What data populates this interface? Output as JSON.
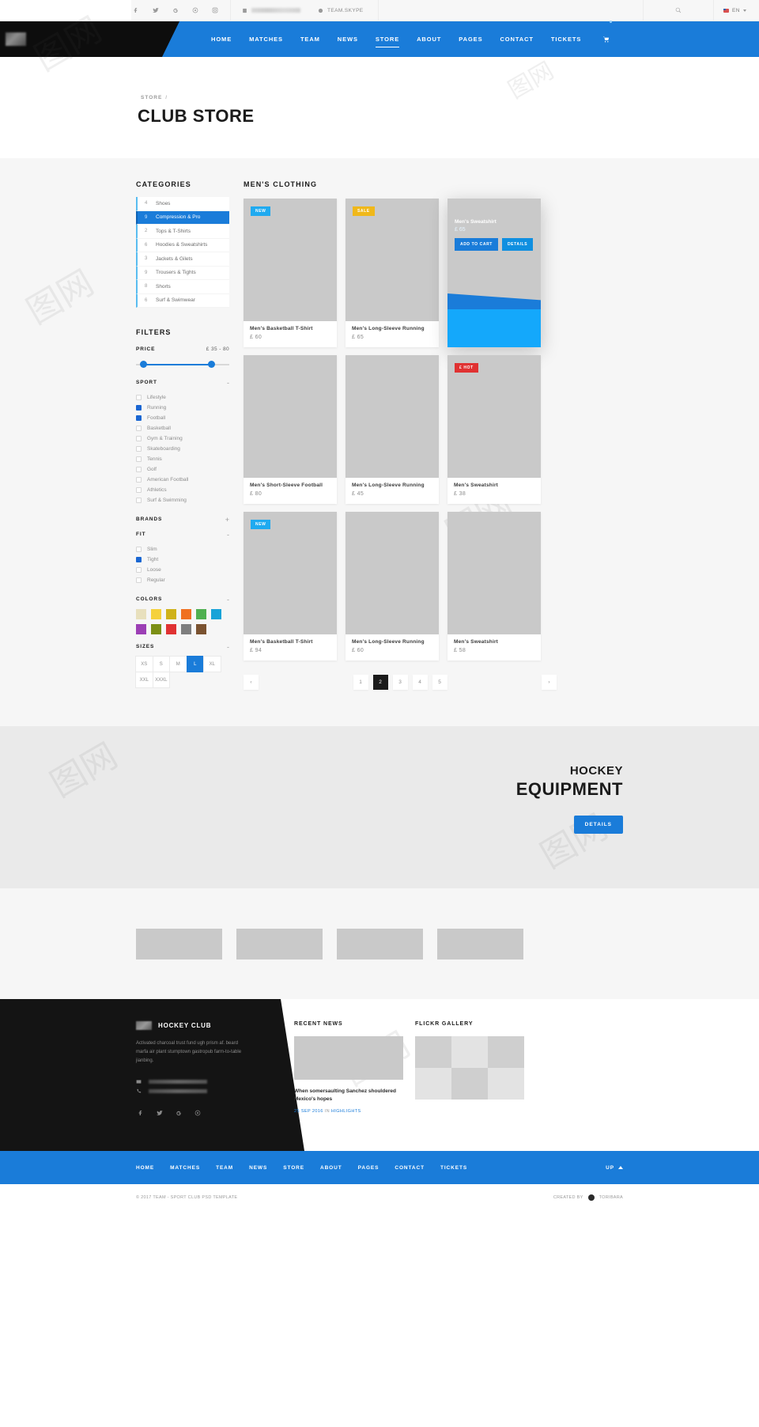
{
  "topbar": {
    "social": [
      "facebook-icon",
      "twitter-icon",
      "google-plus-icon",
      "pinterest-icon",
      "instagram-icon"
    ],
    "phone_masked": "",
    "skype_label": "TEAM.SKYPE",
    "search_icon": "search-icon",
    "language": "EN"
  },
  "nav": {
    "links": [
      {
        "label": "HOME",
        "active": false
      },
      {
        "label": "MATCHES",
        "active": false
      },
      {
        "label": "TEAM",
        "active": false
      },
      {
        "label": "NEWS",
        "active": false
      },
      {
        "label": "STORE",
        "active": true
      },
      {
        "label": "ABOUT",
        "active": false
      },
      {
        "label": "PAGES",
        "active": false
      },
      {
        "label": "CONTACT",
        "active": false
      },
      {
        "label": "TICKETS",
        "active": false
      }
    ],
    "cart_icon": "shopping-cart-icon"
  },
  "hero": {
    "breadcrumb": "STORE",
    "breadcrumb_sep": "/",
    "title": "CLUB STORE"
  },
  "sidebar": {
    "categories_heading": "CATEGORIES",
    "categories": [
      {
        "count": "4",
        "label": "Shoes",
        "active": false
      },
      {
        "count": "9",
        "label": "Compression & Pro",
        "active": true
      },
      {
        "count": "2",
        "label": "Tops & T-Shirts",
        "active": false
      },
      {
        "count": "6",
        "label": "Hoodies & Sweatshirts",
        "active": false
      },
      {
        "count": "3",
        "label": "Jackets & Gilets",
        "active": false
      },
      {
        "count": "9",
        "label": "Trousers & Tights",
        "active": false
      },
      {
        "count": "8",
        "label": "Shorts",
        "active": false
      },
      {
        "count": "6",
        "label": "Surf & Swimwear",
        "active": false
      }
    ],
    "filters_heading": "FILTERS",
    "price": {
      "label": "PRICE",
      "value": "£ 35 - 80"
    },
    "sport": {
      "label": "SPORT",
      "toggle": "-",
      "options": [
        {
          "label": "Lifestyle",
          "checked": false
        },
        {
          "label": "Running",
          "checked": true
        },
        {
          "label": "Football",
          "checked": true
        },
        {
          "label": "Basketball",
          "checked": false
        },
        {
          "label": "Gym & Training",
          "checked": false
        },
        {
          "label": "Skateboarding",
          "checked": false
        },
        {
          "label": "Tennis",
          "checked": false
        },
        {
          "label": "Golf",
          "checked": false
        },
        {
          "label": "American Football",
          "checked": false
        },
        {
          "label": "Athletics",
          "checked": false
        },
        {
          "label": "Surf & Swimming",
          "checked": false
        }
      ]
    },
    "brands": {
      "label": "BRANDS",
      "toggle": "+"
    },
    "fit": {
      "label": "FIT",
      "toggle": "-",
      "options": [
        {
          "label": "Slim",
          "checked": false
        },
        {
          "label": "Tight",
          "checked": true
        },
        {
          "label": "Loose",
          "checked": false
        },
        {
          "label": "Regular",
          "checked": false
        }
      ]
    },
    "colors": {
      "label": "COLORS",
      "toggle": "-",
      "swatches": [
        "#e8e0bd",
        "#f5d13c",
        "#cfb21a",
        "#f07020",
        "#4fb050",
        "#18a3d8",
        "#9c3fb5",
        "#7c8f15",
        "#e03232",
        "#7e7e7e",
        "#7a5230"
      ]
    },
    "sizes": {
      "label": "SIZES",
      "toggle": "-",
      "options": [
        {
          "label": "XS",
          "selected": false
        },
        {
          "label": "S",
          "selected": false
        },
        {
          "label": "M",
          "selected": false
        },
        {
          "label": "L",
          "selected": true
        },
        {
          "label": "XL",
          "selected": false
        },
        {
          "label": "XXL",
          "selected": false
        },
        {
          "label": "XXXL",
          "selected": false
        }
      ]
    }
  },
  "products": {
    "heading": "MEN'S CLOTHING",
    "items": [
      {
        "name": "Men's Basketball T-Shirt",
        "price": "£ 60",
        "badge": "NEW",
        "badge_type": "new",
        "hover": false
      },
      {
        "name": "Men's Long-Sleeve Running",
        "price": "£ 65",
        "badge": "SALE",
        "badge_type": "sale",
        "hover": false
      },
      {
        "name": "Men's Sweatshirt",
        "price": "£ 65",
        "badge": "",
        "badge_type": "",
        "hover": true,
        "add_to_cart": "ADD TO CART",
        "details": "DETAILS"
      },
      {
        "name": "Men's Short-Sleeve Football",
        "price": "£ 80",
        "badge": "",
        "badge_type": "",
        "hover": false
      },
      {
        "name": "Men's Long-Sleeve Running",
        "price": "£ 45",
        "badge": "",
        "badge_type": "",
        "hover": false
      },
      {
        "name": "Men's Sweatshirt",
        "price": "£ 38",
        "badge": "£ HOT",
        "badge_type": "hot",
        "hover": false
      },
      {
        "name": "Men's Basketball T-Shirt",
        "price": "£ 94",
        "badge": "NEW",
        "badge_type": "new",
        "hover": false
      },
      {
        "name": "Men's Long-Sleeve Running",
        "price": "£ 60",
        "badge": "",
        "badge_type": "",
        "hover": false
      },
      {
        "name": "Men's Sweatshirt",
        "price": "£ 58",
        "badge": "",
        "badge_type": "",
        "hover": false
      }
    ],
    "pagination": {
      "prev": "‹",
      "next": "›",
      "pages": [
        "1",
        "2",
        "3",
        "4",
        "5"
      ],
      "current": "2"
    }
  },
  "equipment": {
    "subtitle": "HOCKEY",
    "title": "EQUIPMENT",
    "button": "DETAILS"
  },
  "brand_strip": {
    "count": 4
  },
  "footer": {
    "club_name": "HOCKEY CLUB",
    "description": "Activated charcoal trust fund ugh prism af. beard marfa air plant stumptown gastropub farm-to-table jianbing.",
    "email_icon": "envelope-icon",
    "phone_icon": "phone-icon",
    "social": [
      "facebook-icon",
      "twitter-icon",
      "google-plus-icon",
      "pinterest-icon"
    ],
    "recent_news_heading": "RECENT NEWS",
    "news_title": "When somersaulting Sanchez shouldered Mexico's hopes",
    "news_date": "25 SEP 2016",
    "news_in": "IN",
    "news_category": "HIGHLIGHTS",
    "flickr_heading": "FLICKR GALLERY"
  },
  "bottom_nav": {
    "links": [
      "HOME",
      "MATCHES",
      "TEAM",
      "NEWS",
      "STORE",
      "ABOUT",
      "PAGES",
      "CONTACT",
      "TICKETS"
    ],
    "up_label": "UP"
  },
  "copyright": {
    "left": "© 2017 TEAM - SPORT CLUB PSD TEMPLATE",
    "created_by": "CREATED BY",
    "author": "TORIBARA"
  }
}
